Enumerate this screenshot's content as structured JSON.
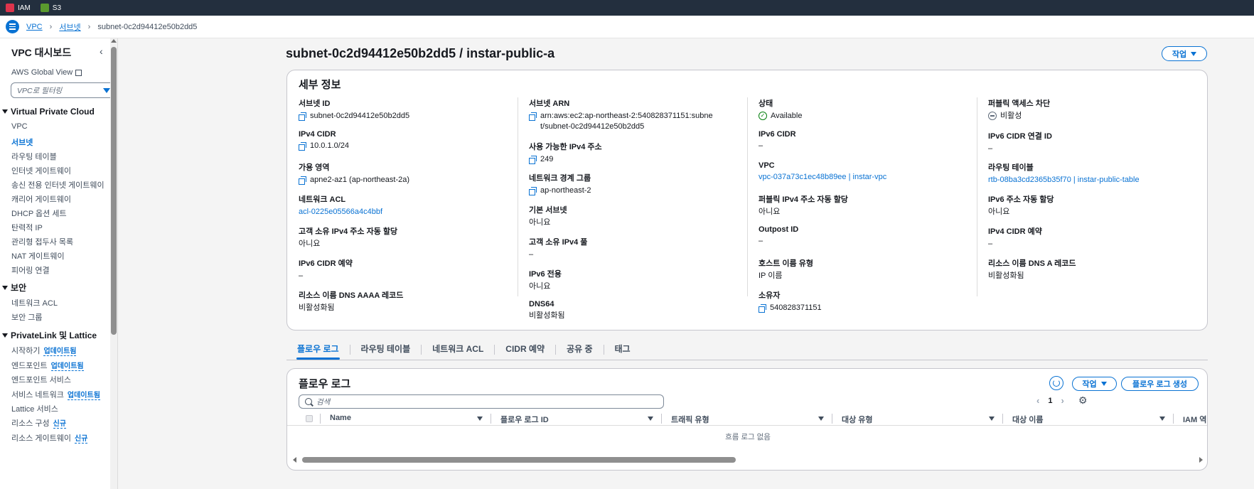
{
  "topbar": {
    "services": [
      {
        "label": "IAM",
        "icon": "iam-icon",
        "color": "#dd344c"
      },
      {
        "label": "S3",
        "icon": "s3-icon",
        "color": "#5a9a2e"
      }
    ]
  },
  "breadcrumb": {
    "items": [
      "VPC",
      "서브넷"
    ],
    "current": "subnet-0c2d94412e50b2dd5"
  },
  "sidebar": {
    "title": "VPC 대시보드",
    "global_view": "AWS Global View",
    "filter_placeholder": "VPC로 필터링",
    "sections": [
      {
        "title": "Virtual Private Cloud",
        "items": [
          "VPC",
          "서브넷",
          "라우팅 테이블",
          "인터넷 게이트웨이",
          "송신 전용 인터넷 게이트웨이",
          "캐리어 게이트웨이",
          "DHCP 옵션 세트",
          "탄력적 IP",
          "관리형 접두사 목록",
          "NAT 게이트웨이",
          "피어링 연결"
        ]
      },
      {
        "title": "보안",
        "items": [
          "네트워크 ACL",
          "보안 그룹"
        ]
      },
      {
        "title": "PrivateLink 및 Lattice",
        "items": [
          "시작하기",
          "엔드포인트",
          "엔드포인트 서비스",
          "서비스 네트워크",
          "Lattice 서비스",
          "리소스 구성",
          "리소스 게이트웨이"
        ]
      }
    ],
    "badges": {
      "update": "업데이트됨",
      "new": "신규"
    }
  },
  "page": {
    "title": "subnet-0c2d94412e50b2dd5 / instar-public-a",
    "actions_label": "작업"
  },
  "details": {
    "title": "세부 정보",
    "col1": [
      {
        "k": "서브넷 ID",
        "v": "subnet-0c2d94412e50b2dd5"
      },
      {
        "k": "IPv4 CIDR",
        "v": "10.0.1.0/24"
      },
      {
        "k": "가용 영역",
        "v": "apne2-az1 (ap-northeast-2a)"
      },
      {
        "k": "네트워크 ACL",
        "v": "acl-0225e05566a4c4bbf"
      },
      {
        "k": "고객 소유 IPv4 주소 자동 할당",
        "v": "아니요"
      },
      {
        "k": "IPv6 CIDR 예약",
        "v": "–"
      },
      {
        "k": "리소스 이름 DNS AAAA 레코드",
        "v": "비활성화됨"
      }
    ],
    "col2": [
      {
        "k": "서브넷 ARN",
        "v": "arn:aws:ec2:ap-northeast-2:540828371151:subnet/subnet-0c2d94412e50b2dd5"
      },
      {
        "k": "사용 가능한 IPv4 주소",
        "v": "249"
      },
      {
        "k": "네트워크 경계 그룹",
        "v": "ap-northeast-2"
      },
      {
        "k": "기본 서브넷",
        "v": "아니요"
      },
      {
        "k": "고객 소유 IPv4 풀",
        "v": "–"
      },
      {
        "k": "IPv6 전용",
        "v": "아니요"
      },
      {
        "k": "DNS64",
        "v": "비활성화됨"
      }
    ],
    "col3": [
      {
        "k": "상태",
        "v": "Available"
      },
      {
        "k": "IPv6 CIDR",
        "v": "–"
      },
      {
        "k": "VPC",
        "v": "vpc-037a73c1ec48b89ee | instar-vpc"
      },
      {
        "k": "퍼블릭 IPv4 주소 자동 할당",
        "v": "아니요"
      },
      {
        "k": "Outpost ID",
        "v": "–"
      },
      {
        "k": "호스트 이름 유형",
        "v": "IP 이름"
      },
      {
        "k": "소유자",
        "v": "540828371151"
      }
    ],
    "col4": [
      {
        "k": "퍼블릭 액세스 차단",
        "v": "비활성"
      },
      {
        "k": "IPv6 CIDR 연결 ID",
        "v": "–"
      },
      {
        "k": "라우팅 테이블",
        "v": "rtb-08ba3cd2365b35f70 | instar-public-table"
      },
      {
        "k": "IPv6 주소 자동 할당",
        "v": "아니요"
      },
      {
        "k": "IPv4 CIDR 예약",
        "v": "–"
      },
      {
        "k": "리소스 이름 DNS A 레코드",
        "v": "비활성화됨"
      }
    ]
  },
  "tabs": [
    "플로우 로그",
    "라우팅 테이블",
    "네트워크 ACL",
    "CIDR 예약",
    "공유 중",
    "태그"
  ],
  "flow_logs": {
    "title": "플로우 로그",
    "actions_label": "작업",
    "create_label": "플로우 로그 생성",
    "search_placeholder": "검색",
    "page": "1",
    "columns": [
      "Name",
      "플로우 로그 ID",
      "트래픽 유형",
      "대상 유형",
      "대상 이름",
      "IAM 역"
    ],
    "empty_text": "흐름 로그 없음"
  },
  "colors": {
    "accent": "#0972d3",
    "topbar": "#232f3e",
    "success": "#037f0c"
  }
}
